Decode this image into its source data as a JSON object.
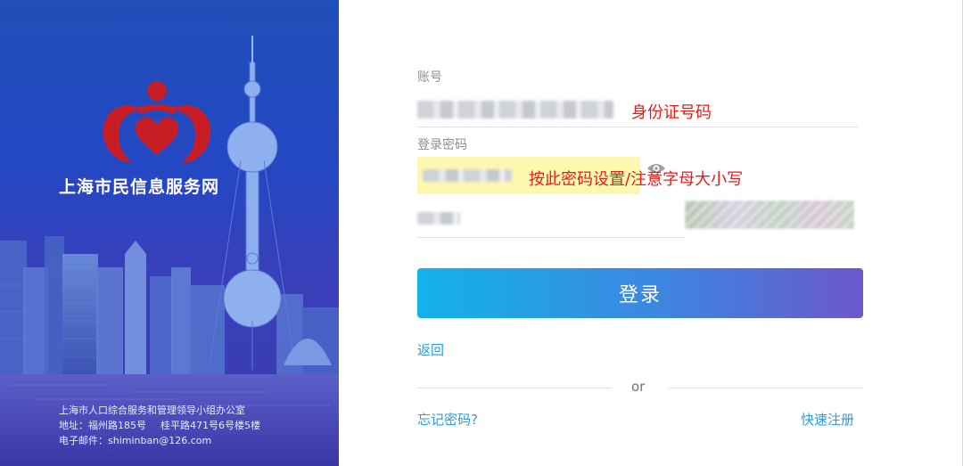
{
  "brand": {
    "title": "上海市民信息服务网",
    "office": "上海市人口综合服务和管理领导小组办公室",
    "address_label": "地址：",
    "address_1": "福州路185号",
    "address_2": "桂平路471号6号楼5楼",
    "email_label": "电子邮件：",
    "email": "shiminban@126.com",
    "logo_icon": "heart-people-logo-icon"
  },
  "form": {
    "account_label": "账号",
    "account_annotation": "身份证号码",
    "password_label": "登录密码",
    "password_annotation": "按此密码设置/注意字母大小写",
    "login_button": "登录",
    "back_link": "返回",
    "or_text": "or",
    "forgot_link": "忘记密码?",
    "register_link": "快速注册"
  },
  "colors": {
    "brand_blue": "#2448c4",
    "button_gradient_start": "#12b3e8",
    "button_gradient_end": "#6b57cc",
    "link": "#2f9ad8",
    "annotation_red": "#e0201c",
    "logo_red": "#c81d25"
  }
}
